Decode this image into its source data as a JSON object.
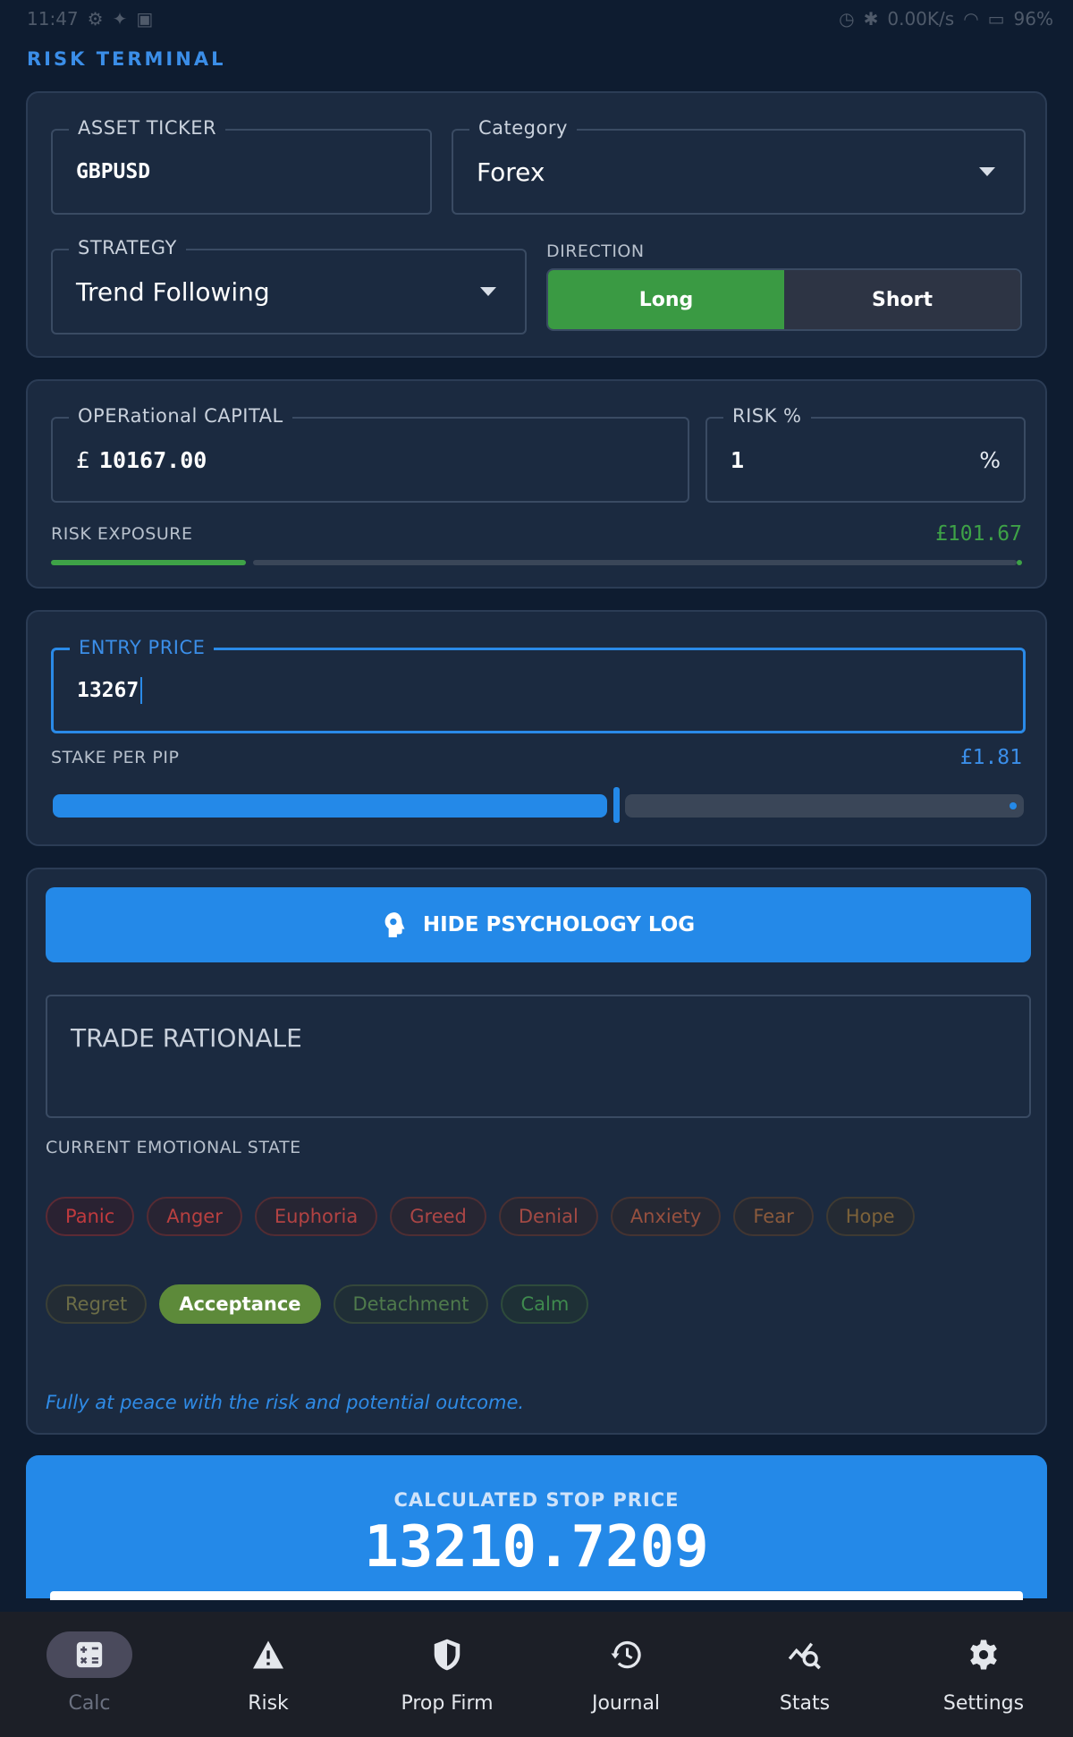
{
  "status_bar": {
    "time": "11:47",
    "network_speed": "0.00K/s",
    "battery": "96%"
  },
  "app": {
    "title": "RISK TERMINAL"
  },
  "asset": {
    "ticker_label": "ASSET TICKER",
    "ticker_value": "GBPUSD",
    "category_label": "Category",
    "category_value": "Forex",
    "strategy_label": "STRATEGY",
    "strategy_value": "Trend Following",
    "direction_label": "DIRECTION",
    "long_label": "Long",
    "short_label": "Short",
    "direction_selected": "Long"
  },
  "capital": {
    "label": "OPERational CAPITAL",
    "currency": "£",
    "value": "10167.00",
    "risk_label": "RISK %",
    "risk_value": "1",
    "risk_unit": "%",
    "exposure_label": "RISK EXPOSURE",
    "exposure_value": "£101.67",
    "exposure_fraction": 0.2
  },
  "entry": {
    "label": "ENTRY PRICE",
    "value": "13267",
    "stake_label": "STAKE PER PIP",
    "stake_value": "£1.81",
    "stake_slider_fraction": 0.58
  },
  "psychology": {
    "toggle_label": "HIDE PSYCHOLOGY LOG",
    "rationale_placeholder": "TRADE RATIONALE",
    "emotion_label": "CURRENT EMOTIONAL STATE",
    "emotions_row1": [
      "Panic",
      "Anger",
      "Euphoria",
      "Greed",
      "Denial",
      "Anxiety",
      "Fear",
      "Hope"
    ],
    "emotions_row2": [
      "Regret",
      "Acceptance",
      "Detachment",
      "Calm"
    ],
    "selected": "Acceptance",
    "description": "Fully at peace with the risk and potential outcome."
  },
  "result": {
    "label": "CALCULATED STOP PRICE",
    "value": "13210.7209"
  },
  "nav": [
    {
      "label": "Calc",
      "icon": "calculator-icon",
      "active": true
    },
    {
      "label": "Risk",
      "icon": "warning-icon",
      "active": false
    },
    {
      "label": "Prop Firm",
      "icon": "shield-icon",
      "active": false
    },
    {
      "label": "Journal",
      "icon": "history-icon",
      "active": false
    },
    {
      "label": "Stats",
      "icon": "stats-search-icon",
      "active": false
    },
    {
      "label": "Settings",
      "icon": "gear-icon",
      "active": false
    }
  ],
  "colors": {
    "accent": "#2489e8",
    "long_active": "#3a9a43",
    "exposure_green": "#3ea247",
    "selected_chip": "#5d8a3a",
    "background": "#0e1c30",
    "card": "#1b2a40"
  }
}
